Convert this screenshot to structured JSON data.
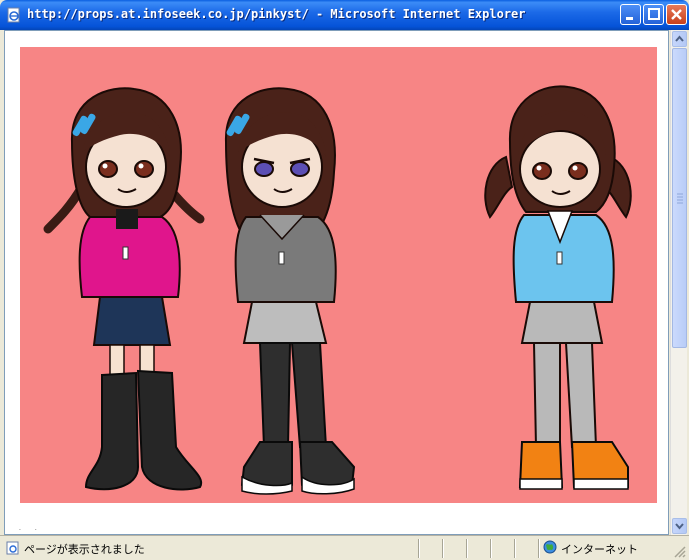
{
  "window": {
    "title": "http://props.at.infoseek.co.jp/pinkyst/ - Microsoft Internet Explorer",
    "icon": "ie-page-icon"
  },
  "buttons": {
    "minimize": "minimize-icon",
    "maximize": "maximize-icon",
    "close": "close-icon"
  },
  "content": {
    "background": "#F78585",
    "characters": [
      {
        "jacket": "#E0158C",
        "skirt": "#1E3558",
        "legs": "#F7E2D0",
        "boots": "#262626",
        "eyes": "#7A2E1E",
        "hair_clip": true,
        "pigtails": "braids"
      },
      {
        "jacket": "#7A7A7A",
        "skirt": "#BDBDBD",
        "legs": "#2E2E2E",
        "boots": "#2E2E2E",
        "eyes": "#5C4FB4",
        "hair_clip": true,
        "pigtails": "none"
      },
      {
        "jacket": "#6CC4EE",
        "skirt": "#B9B9B9",
        "legs": "#B9B9B9",
        "boots": "#F28213",
        "eyes": "#7A2E1E",
        "hair_clip": false,
        "pigtails": "tails"
      }
    ]
  },
  "statusbar": {
    "text": "ページが表示されました",
    "zone": "インターネット",
    "zone_icon": "globe-icon"
  }
}
